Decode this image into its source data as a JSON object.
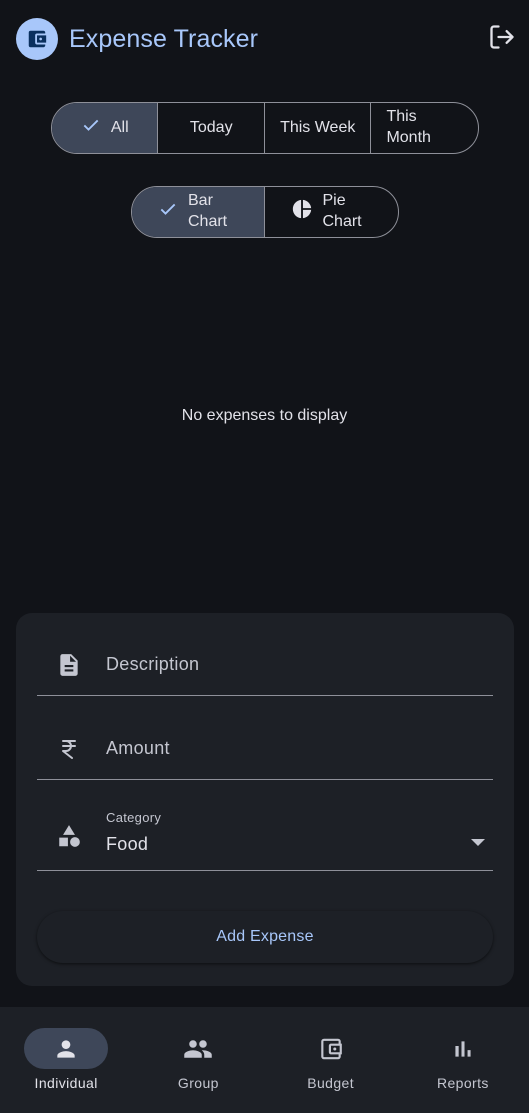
{
  "header": {
    "title": "Expense Tracker",
    "logo_icon": "wallet-icon",
    "logout_icon": "logout-icon"
  },
  "filters": {
    "selected": "All",
    "options": [
      {
        "label": "All",
        "selected": true
      },
      {
        "label": "Today",
        "selected": false
      },
      {
        "label": "This Week",
        "selected": false
      },
      {
        "label": "This Month",
        "selected": false
      }
    ]
  },
  "chart_toggle": {
    "options": [
      {
        "label": "Bar Chart",
        "icon": "check-icon",
        "selected": true
      },
      {
        "label": "Pie Chart",
        "icon": "pie-chart-icon",
        "selected": false
      }
    ]
  },
  "chart_area": {
    "empty_message": "No expenses to display"
  },
  "form": {
    "description_placeholder": "Description",
    "amount_placeholder": "Amount",
    "category_label": "Category",
    "category_value": "Food",
    "submit_label": "Add Expense"
  },
  "bottom_nav": {
    "items": [
      {
        "label": "Individual",
        "icon": "person-icon",
        "active": true
      },
      {
        "label": "Group",
        "icon": "group-icon",
        "active": false
      },
      {
        "label": "Budget",
        "icon": "wallet-icon",
        "active": false
      },
      {
        "label": "Reports",
        "icon": "bar-chart-icon",
        "active": false
      }
    ]
  },
  "colors": {
    "background": "#111318",
    "surface": "#1d2026",
    "primary": "#a8c7fa",
    "selected": "#3e4759",
    "outline": "#8e9099"
  }
}
